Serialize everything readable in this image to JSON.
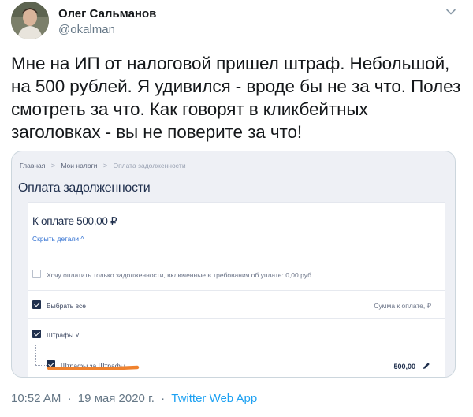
{
  "author": {
    "name": "Олег Сальманов",
    "handle": "@okalman"
  },
  "tweet": {
    "text": "Мне на ИП от налоговой пришел штраф. Небольшой, на 500 рублей. Я удивился - вроде бы не за что. Полез смотреть за что. Как говорят в кликбейтных заголовках - вы не поверите за что!"
  },
  "screenshot": {
    "breadcrumb": {
      "home": "Главная",
      "my_taxes": "Мои налоги",
      "current": "Оплата задолженности",
      "separator": ">"
    },
    "title": "Оплата задолженности",
    "amount_label": "К оплате 500,00 ₽",
    "toggle_details": "Скрыть детали ^",
    "only_debts_option": "Хочу оплатить только задолженности, включенные в требования об уплате: 0,00 руб.",
    "select_all": "Выбрать все",
    "sum_header": "Сумма к оплате, ₽",
    "group_label": "Штрафы ˅",
    "item_label": "Штрафы за Штрафы",
    "item_sum": "500,00",
    "underline_color": "#f0822e"
  },
  "footer": {
    "time": "10:52 AM",
    "dot": "·",
    "date": "19 мая 2020 г.",
    "dot2": "·",
    "app": "Twitter Web App"
  }
}
